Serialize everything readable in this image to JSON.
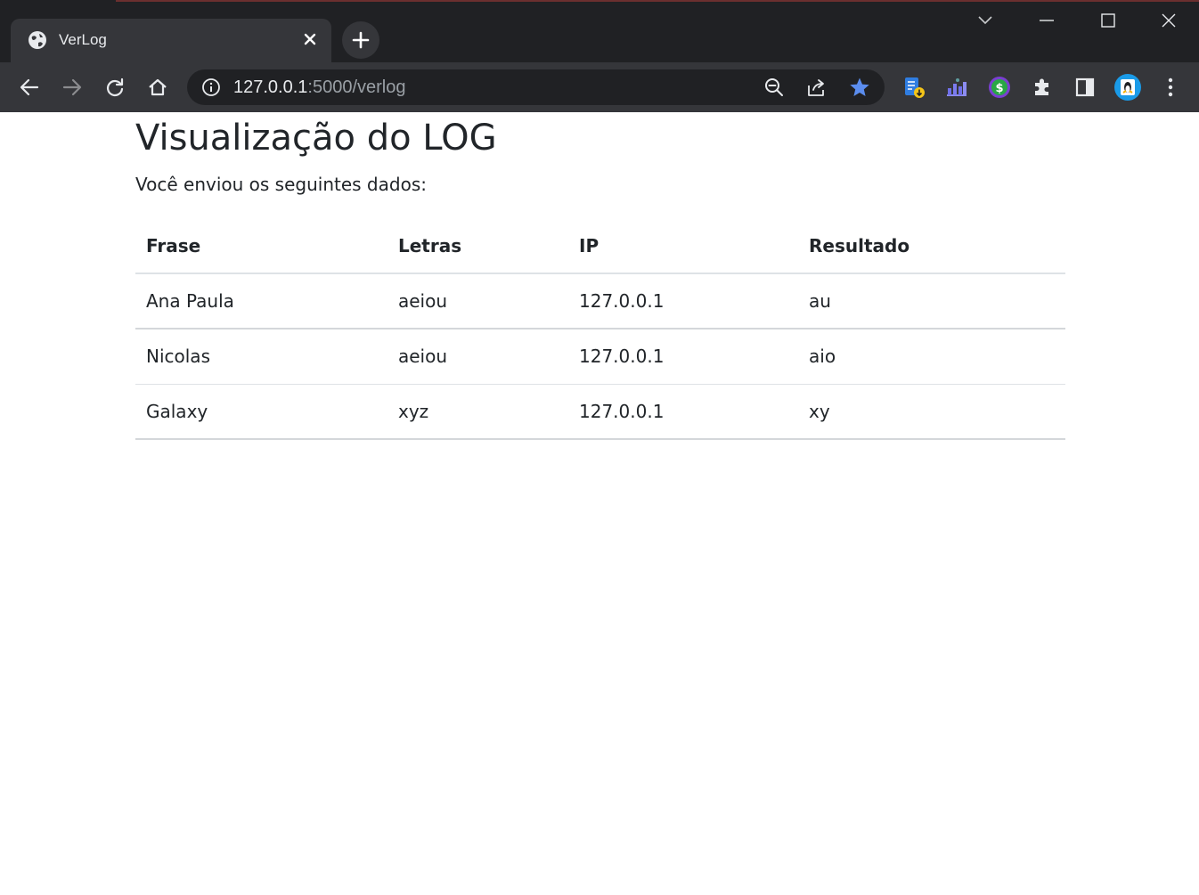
{
  "browser": {
    "tab": {
      "title": "VerLog"
    },
    "address": {
      "host": "127.0.0.1",
      "rest": ":5000/verlog"
    }
  },
  "page": {
    "heading": "Visualização do LOG",
    "intro": "Você enviou os seguintes dados:",
    "table": {
      "headers": [
        "Frase",
        "Letras",
        "IP",
        "Resultado"
      ],
      "rows": [
        [
          "Ana Paula",
          "aeiou",
          "127.0.0.1",
          "au"
        ],
        [
          "Nicolas",
          "aeiou",
          "127.0.0.1",
          "aio"
        ],
        [
          "Galaxy",
          "xyz",
          "127.0.0.1",
          "xy"
        ]
      ]
    }
  },
  "icons": {
    "tab_favicon": "globe-icon",
    "tab_close": "close-icon",
    "new_tab": "plus-icon",
    "back": "arrow-left-icon",
    "forward": "arrow-right-icon",
    "reload": "reload-icon",
    "home": "home-icon",
    "site_info": "info-icon",
    "zoom": "zoom-out-icon",
    "share": "share-icon",
    "bookmark": "star-icon",
    "extensions": "puzzle-icon",
    "side_panel": "side-panel-icon",
    "menu": "kebab-menu-icon"
  },
  "colors": {
    "bookmark_star": "#5b8def",
    "profile_ring": "#1a9be8"
  }
}
